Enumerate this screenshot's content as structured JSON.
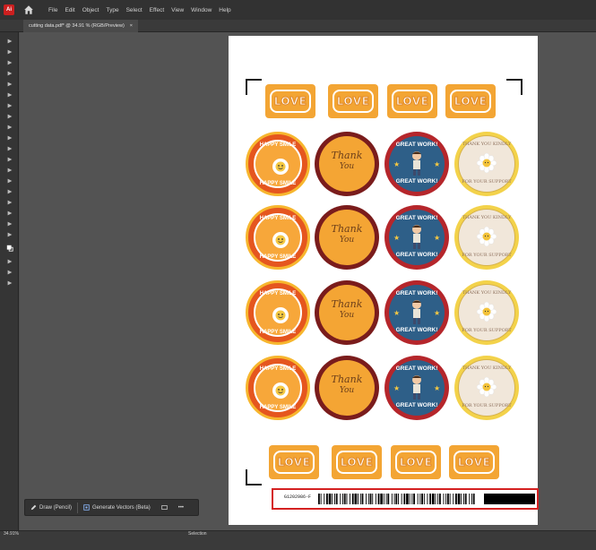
{
  "app": {
    "icon": "Ai"
  },
  "menu": [
    "File",
    "Edit",
    "Object",
    "Type",
    "Select",
    "Effect",
    "View",
    "Window",
    "Help"
  ],
  "document_tab": {
    "title": "cutting data.pdf* @ 34.91 % (RGB/Preview)",
    "close": "×"
  },
  "tools": [
    "selection-icon",
    "direct-selection-icon",
    "pen-icon",
    "pencil-icon",
    "rectangle-icon",
    "brush-icon",
    "type-icon",
    "rotate-icon",
    "eraser-icon",
    "scale-icon",
    "warp-icon",
    "eyedropper-icon",
    "blend-icon",
    "symbol-sprayer-icon",
    "graph-icon",
    "artboard-icon",
    "slice-icon",
    "hand-icon",
    "zoom-icon",
    "fill-stroke-icon",
    "draw-mode-icon",
    "screen-mode-icon",
    "more-tools-icon"
  ],
  "artwork": {
    "love_label": "LOVE",
    "smile": {
      "top": "HAPPY SMILE",
      "bottom": "HAPPY SMILE"
    },
    "thank": {
      "line1": "Thank",
      "line2": "You"
    },
    "great": {
      "top": "GREAT WORK!",
      "bottom": "GREAT WORK!"
    },
    "kindly": {
      "top": "THANK YOU KINDLY",
      "bottom": "FOR YOUR SUPPORT"
    }
  },
  "barcode": {
    "code": "G1202986-F"
  },
  "floating_bar": {
    "draw": "Draw (Pencil)",
    "vectorize": "Generate Vectors (Beta)",
    "more": "•••"
  },
  "status": {
    "zoom": "34.91%",
    "tool": "Selection"
  },
  "colors": {
    "orange": "#f3a534",
    "red_frame": "#d42020",
    "dark_red": "#7a1c1c",
    "blue": "#2e5f88",
    "yellow": "#f3d24a"
  }
}
